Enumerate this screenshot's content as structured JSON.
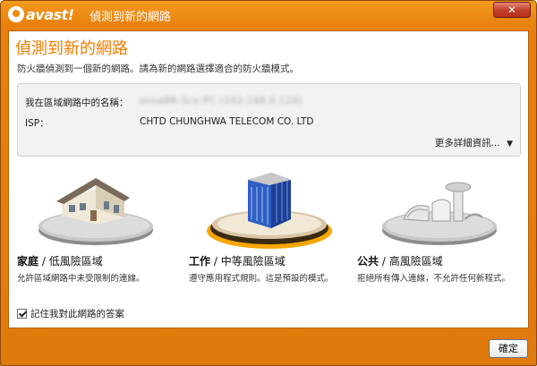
{
  "window": {
    "brand": "avast!",
    "title": "偵測到新的網路",
    "close_label": "✕"
  },
  "header": {
    "heading": "偵測到新的網路",
    "subtitle": "防火牆偵測到一個新的網路。請為新的網路選擇適合的防火牆模式。"
  },
  "network_info": {
    "name_label": "我在區域網路中的名稱：",
    "name_value": "onsaBR-Sce-PC (192.168.0.120)",
    "isp_label": "ISP：",
    "isp_value": "CHTD CHUNGHWA TELECOM CO. LTD",
    "more_details": "更多詳細資訊...",
    "more_icon": "▼"
  },
  "zones": [
    {
      "title_bold": "家庭",
      "title_rest": " / 低風險區域",
      "desc": "允許區域網路中未受限制的連線。",
      "selected": false
    },
    {
      "title_bold": "工作",
      "title_rest": " / 中等風險區域",
      "desc": "遵守應用程式規則。這是預設的模式。",
      "selected": true
    },
    {
      "title_bold": "公共",
      "title_rest": " / 高風險區域",
      "desc": "拒絕所有傳入連線，不允許任何新程式。",
      "selected": false
    }
  ],
  "remember_label": "記住我對此網路的答案",
  "remember_checked": true,
  "ok_label": "確定",
  "colors": {
    "accent": "#f07d00",
    "frame": "#e9800e",
    "selected_ring": "#f7a600"
  }
}
